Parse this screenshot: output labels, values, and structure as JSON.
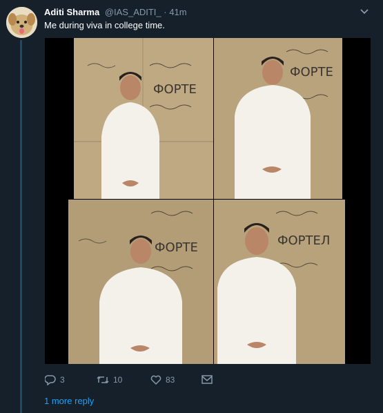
{
  "tweet": {
    "author_name": "Aditi Sharma",
    "author_handle": "@IAS_ADITI_",
    "separator": "·",
    "time": "41m",
    "text": "Me during viva in college time."
  },
  "actions": {
    "reply_count": "3",
    "retweet_count": "10",
    "like_count": "83"
  },
  "thread": {
    "more_replies": "1 more reply"
  },
  "wall_text": {
    "word_a": "ФОРТЕ",
    "word_b": "ФОРТЕ",
    "word_c": "ФОРТЕ",
    "word_d": "ФОРТЕЛ"
  },
  "colors": {
    "background": "#15202b",
    "secondary_text": "#8899a6",
    "accent": "#1da1f2",
    "thread_line": "#1d4a6b"
  }
}
